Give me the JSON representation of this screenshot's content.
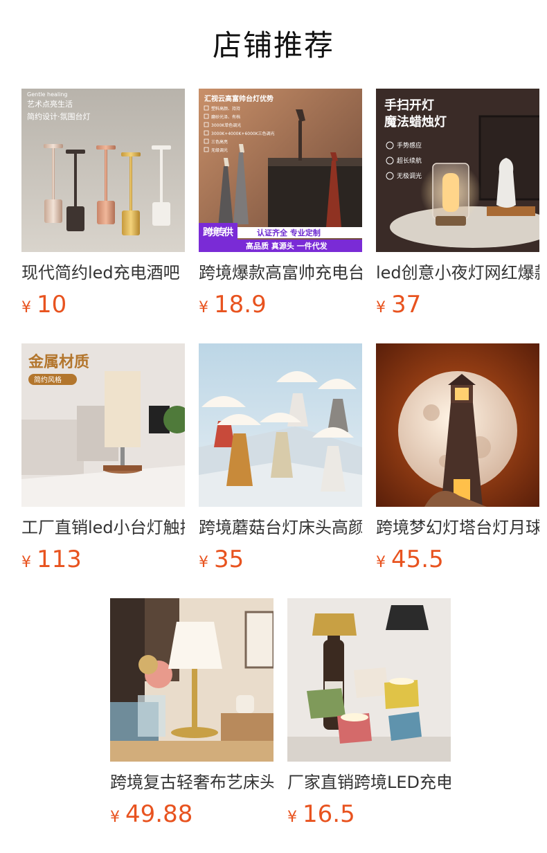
{
  "header": {
    "title": "店铺推荐"
  },
  "currency": "¥",
  "colors": {
    "price": "#e8531f",
    "title": "#111111"
  },
  "products": [
    {
      "name": "现代简约led充电酒吧",
      "price": "10",
      "image_text": {
        "line1": "Gentle healing",
        "line2": "艺术点亮生活",
        "line3": "简约设计·氛围台灯"
      }
    },
    {
      "name": "跨境爆款高富帅充电台",
      "price": "18.9",
      "image_text": {
        "heading": "汇视云高富帅台灯优势",
        "features": [
          "塑料高颜、持持",
          "磨砂光泽、有档",
          "3000K单色调光",
          "3000K+4000K+6000K三色调光",
          "三色高亮",
          "无级调光"
        ],
        "badge": "跨境专供",
        "banner1": "认证齐全   专业定制",
        "banner2": "高品质  真源头  一件代发"
      }
    },
    {
      "name": "led创意小夜灯网红爆款",
      "price": "37",
      "image_text": {
        "line1": "手扫开灯",
        "line2": "魔法蜡烛灯",
        "f1": "手势感应",
        "f2": "超长续航",
        "f3": "无极调光"
      }
    },
    {
      "name": "工厂直销led小台灯触摸",
      "price": "113",
      "image_text": {
        "line1": "金属材质",
        "line2": "简约风格"
      }
    },
    {
      "name": "跨境蘑菇台灯床头高颜值",
      "price": "35"
    },
    {
      "name": "跨境梦幻灯塔台灯月球",
      "price": "45.5"
    },
    {
      "name": "跨境复古轻奢布艺床头",
      "price": "49.88"
    },
    {
      "name": "厂家直销跨境LED充电",
      "price": "16.5"
    }
  ]
}
